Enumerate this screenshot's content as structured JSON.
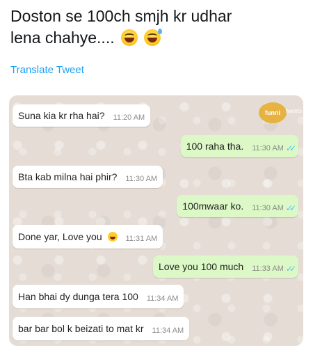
{
  "tweet": {
    "text_line1": "Doston se 100ch smjh kr udhar",
    "text_line2": "lena chahye....",
    "emojis": [
      "grinning-squinting-face",
      "grinning-sweat-face"
    ],
    "translate_link": "Translate Tweet"
  },
  "watermark": {
    "name": "funni",
    "sub": "tweets"
  },
  "chat": {
    "messages": [
      {
        "dir": "in",
        "text": "Suna kia kr rha hai?",
        "time": "11:20 AM"
      },
      {
        "dir": "out",
        "text": "100 raha tha.",
        "time": "11:30 AM",
        "status": "read"
      },
      {
        "dir": "in",
        "text": "Bta kab milna hai phir?",
        "time": "11:30 AM"
      },
      {
        "dir": "out",
        "text": "100mwaar ko.",
        "time": "11:30 AM",
        "status": "read"
      },
      {
        "dir": "in",
        "text": "Done yar, Love you",
        "time": "11:31 AM",
        "emoji": "grinning-sweat-face"
      },
      {
        "dir": "out",
        "text": "Love you 100 much",
        "time": "11:33 AM",
        "status": "read"
      },
      {
        "dir": "in",
        "text": "Han bhai dy dunga tera 100",
        "time": "11:34 AM"
      },
      {
        "dir": "in",
        "text": "bar bar bol k beizati to mat kr",
        "time": "11:34 AM"
      }
    ],
    "colors": {
      "incoming": "#ffffff",
      "outgoing": "#dcf8c6",
      "read_ticks": "#4fc3f7"
    }
  }
}
